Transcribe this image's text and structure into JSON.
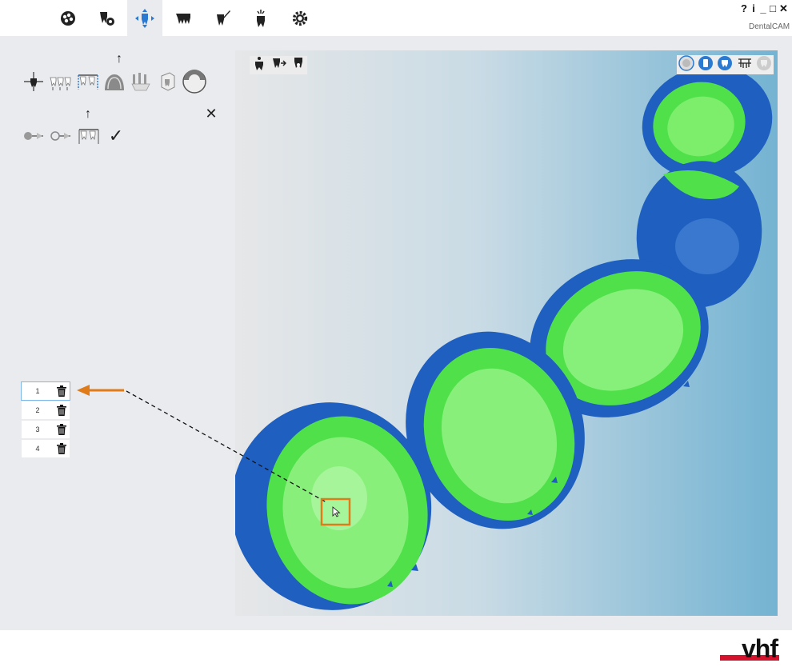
{
  "app": {
    "brand": "DentalCAM"
  },
  "window_controls": {
    "help": "?",
    "info": "i",
    "minimize": "_",
    "maximize": "□",
    "close": "✕"
  },
  "main_toolbar": {
    "items": [
      {
        "name": "job-icon",
        "active": false
      },
      {
        "name": "material-icon",
        "active": false
      },
      {
        "name": "positioning-icon",
        "active": true
      },
      {
        "name": "restoration-icon",
        "active": false
      },
      {
        "name": "tool-icon",
        "active": false
      },
      {
        "name": "calculation-icon",
        "active": false
      },
      {
        "name": "settings-icon",
        "active": false
      }
    ]
  },
  "left_panel": {
    "tool_row_1": [
      "rotate-object-icon",
      "move-object-icon",
      "sinter-frame-icon",
      "connector-icon",
      "support-icon",
      "blank-icon",
      "blank-section-icon"
    ],
    "tool_row_2": [
      "sprue-icon",
      "sprue-alt-icon",
      "sprue-add-icon"
    ],
    "up_arrow": "↑",
    "close": "✕",
    "confirm": "✓",
    "list": {
      "rows": [
        {
          "number": "1",
          "selected": true
        },
        {
          "number": "2",
          "selected": false
        },
        {
          "number": "3",
          "selected": false
        },
        {
          "number": "4",
          "selected": false
        }
      ]
    }
  },
  "viewport": {
    "top_tools": [
      "tooth-view-icon",
      "tooth-next-icon",
      "tooth-sprue-icon"
    ],
    "view_tools": [
      "view-all-icon",
      "view-front-icon",
      "view-inner-icon",
      "view-connectors-icon",
      "view-blank-icon"
    ],
    "colors": {
      "model": "#1f5fbf",
      "highlight": "#55e64a",
      "accent": "#e07b1a",
      "gradient_end": "#74b3d2"
    }
  },
  "logo": {
    "text": "vhf",
    "color": "#d3122e"
  }
}
